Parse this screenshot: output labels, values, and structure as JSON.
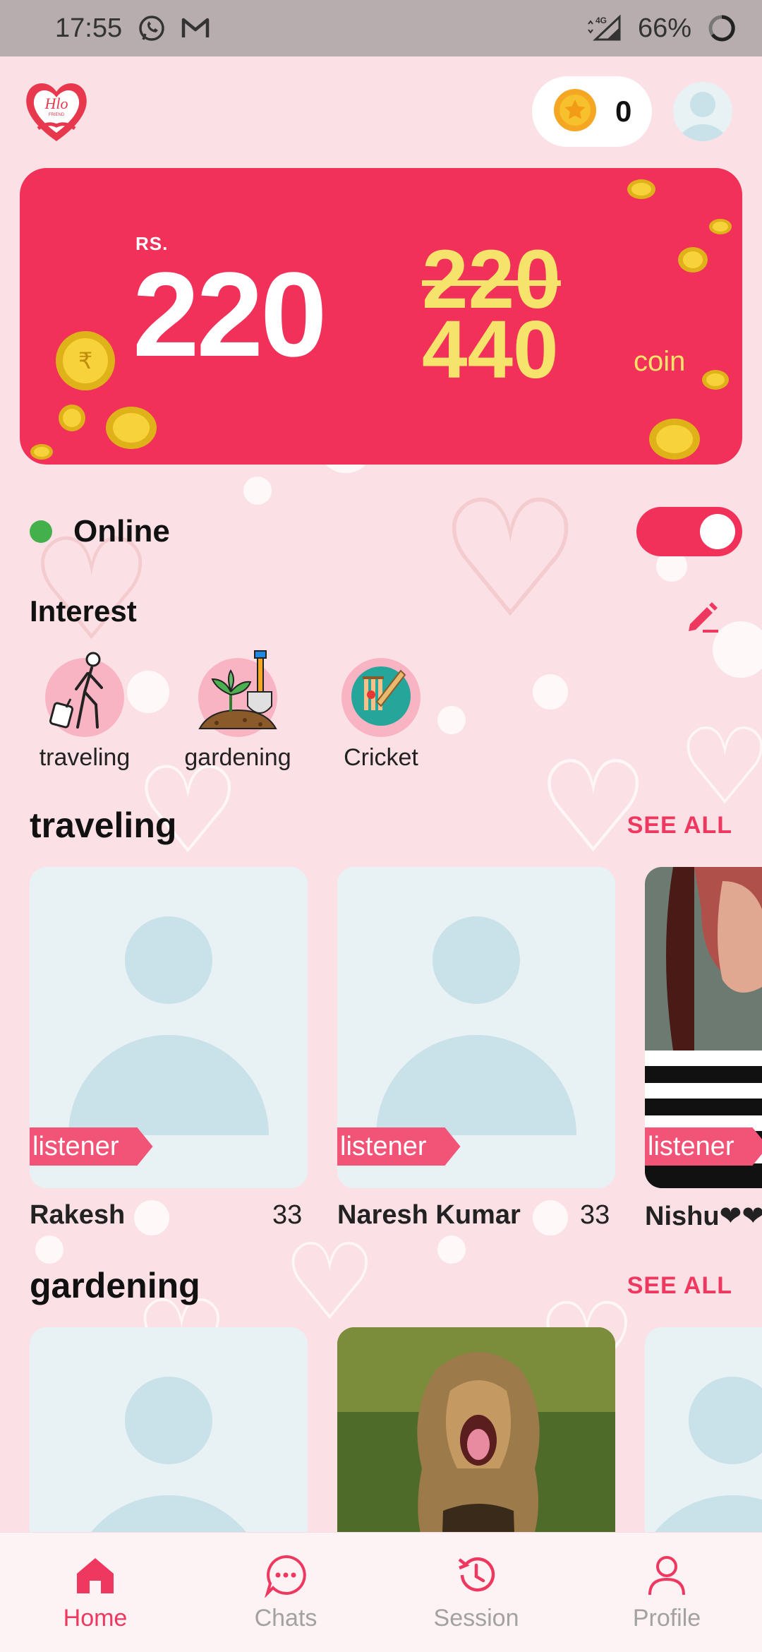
{
  "status_bar": {
    "time": "17:55",
    "network": "4G",
    "battery": "66%"
  },
  "header": {
    "logo_text": "Hlo",
    "logo_sub": "FRIEND",
    "coin_count": "0"
  },
  "banner": {
    "currency": "RS.",
    "price": "220",
    "old_coins": "220",
    "new_coins": "440",
    "unit": "coin"
  },
  "online": {
    "label": "Online",
    "enabled": true
  },
  "interest": {
    "title": "Interest",
    "items": [
      {
        "label": "traveling"
      },
      {
        "label": "gardening"
      },
      {
        "label": "Cricket"
      }
    ]
  },
  "sections": [
    {
      "title": "traveling",
      "see_all": "SEE ALL",
      "cards": [
        {
          "name": "Rakesh",
          "age": "33",
          "tag": "listener"
        },
        {
          "name": "Naresh Kumar",
          "age": "33",
          "tag": "listener"
        },
        {
          "name": "Nishu❤❤",
          "age": "",
          "tag": "listener"
        }
      ]
    },
    {
      "title": "gardening",
      "see_all": "SEE ALL",
      "cards": []
    }
  ],
  "bottom_nav": [
    {
      "label": "Home",
      "icon": "home-icon",
      "active": true
    },
    {
      "label": "Chats",
      "icon": "chat-icon",
      "active": false
    },
    {
      "label": "Session",
      "icon": "history-icon",
      "active": false
    },
    {
      "label": "Profile",
      "icon": "person-icon",
      "active": false
    }
  ],
  "colors": {
    "accent": "#f2315a",
    "background": "#fbe1e5",
    "online": "#43b04b",
    "coin_gold": "#f6e36b"
  }
}
